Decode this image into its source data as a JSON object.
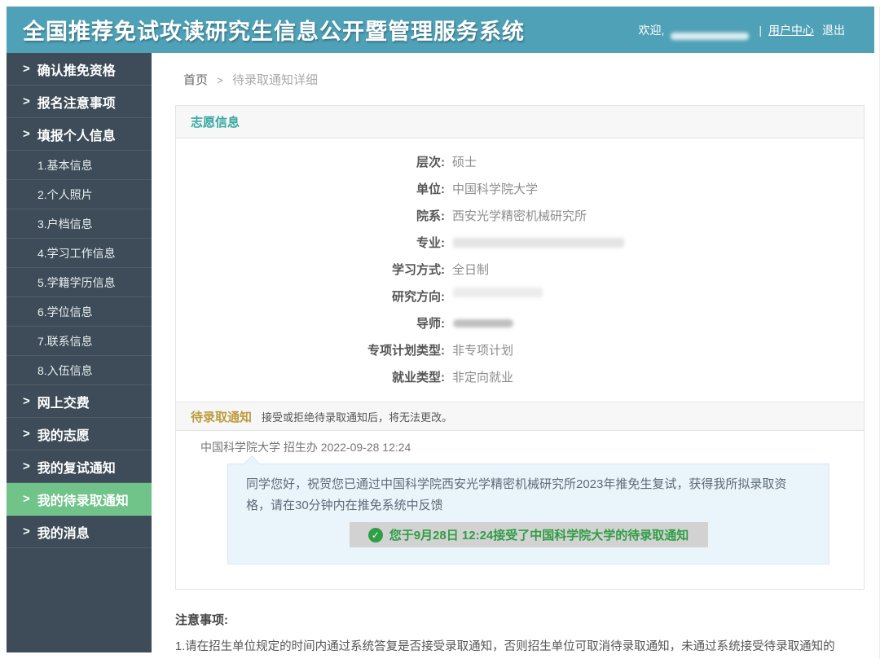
{
  "header": {
    "title": "全国推荐免试攻读研究生信息公开暨管理服务系统",
    "welcome": "欢迎,",
    "divider": "|",
    "user_center": "用户中心",
    "logout": "退出"
  },
  "sidebar": {
    "items": [
      {
        "id": "confirm-eligibility",
        "prefix": ">",
        "label": "确认推免资格",
        "level": 1,
        "active": false
      },
      {
        "id": "application-notes",
        "prefix": ">",
        "label": "报名注意事项",
        "level": 1,
        "active": false
      },
      {
        "id": "fill-personal-info",
        "prefix": ">",
        "label": "填报个人信息",
        "level": 1,
        "active": false
      },
      {
        "id": "basic-info",
        "prefix": "",
        "label": "1.基本信息",
        "level": 2,
        "active": false
      },
      {
        "id": "personal-photo",
        "prefix": "",
        "label": "2.个人照片",
        "level": 2,
        "active": false
      },
      {
        "id": "hukou-file-info",
        "prefix": "",
        "label": "3.户档信息",
        "level": 2,
        "active": false
      },
      {
        "id": "study-work-info",
        "prefix": "",
        "label": "4.学习工作信息",
        "level": 2,
        "active": false
      },
      {
        "id": "student-status-info",
        "prefix": "",
        "label": "5.学籍学历信息",
        "level": 2,
        "active": false
      },
      {
        "id": "degree-info",
        "prefix": "",
        "label": "6.学位信息",
        "level": 2,
        "active": false
      },
      {
        "id": "contact-info",
        "prefix": "",
        "label": "7.联系信息",
        "level": 2,
        "active": false
      },
      {
        "id": "enlistment-info",
        "prefix": "",
        "label": "8.入伍信息",
        "level": 2,
        "active": false
      },
      {
        "id": "online-payment",
        "prefix": ">",
        "label": "网上交费",
        "level": 1,
        "active": false
      },
      {
        "id": "my-volunteer",
        "prefix": ">",
        "label": "我的志愿",
        "level": 1,
        "active": false
      },
      {
        "id": "my-retest-notice",
        "prefix": ">",
        "label": "我的复试通知",
        "level": 1,
        "active": false
      },
      {
        "id": "my-pending-admission-notice",
        "prefix": ">",
        "label": "我的待录取通知",
        "level": 1,
        "active": true
      },
      {
        "id": "my-messages",
        "prefix": ">",
        "label": "我的消息",
        "level": 1,
        "active": false
      }
    ]
  },
  "breadcrumb": {
    "home": "首页",
    "sep": ">",
    "current": "待录取通知详细"
  },
  "panel": {
    "volunteer_header": "志愿信息",
    "fields": [
      {
        "id": "level",
        "label": "层次:",
        "value": "硕士",
        "redacted": false
      },
      {
        "id": "unit",
        "label": "单位:",
        "value": "中国科学院大学",
        "redacted": false
      },
      {
        "id": "department",
        "label": "院系:",
        "value": "西安光学精密机械研究所",
        "redacted": false
      },
      {
        "id": "major",
        "label": "专业:",
        "value": "",
        "redacted": true
      },
      {
        "id": "study-mode",
        "label": "学习方式:",
        "value": "全日制",
        "redacted": false
      },
      {
        "id": "research-direction",
        "label": "研究方向:",
        "value": "",
        "redacted": true
      },
      {
        "id": "supervisor",
        "label": "导师:",
        "value": "",
        "redacted": true
      },
      {
        "id": "special-plan-type",
        "label": "专项计划类型:",
        "value": "非专项计划",
        "redacted": false
      },
      {
        "id": "employment-type",
        "label": "就业类型:",
        "value": "非定向就业",
        "redacted": false
      }
    ],
    "notice_header": {
      "title": "待录取通知",
      "note": "接受或拒绝待录取通知后，将无法更改。"
    },
    "message": {
      "sender": "中国科学院大学 招生办 2022-09-28 12:24",
      "body": "同学您好，祝贺您已通过中国科学院西安光学精密机械研究所2023年推免生复试，获得我所拟录取资格，请在30分钟内在推免系统中反馈",
      "accept_status": "您于9月28日 12:24接受了中国科学院大学的待录取通知"
    }
  },
  "footer_notice": {
    "title": "注意事项:",
    "line1": "1.请在招生单位规定的时间内通过系统答复是否接受录取通知，否则招生单位可取消待录取通知，未通过系统接受待录取通知的"
  },
  "colors": {
    "header_teal": "#4fa1b7",
    "sidebar_dark": "#3d4c58",
    "active_green": "#70c389",
    "section_title_teal": "#3aa7a3",
    "pending_gold": "#bd9b3d",
    "success_green": "#2f9e44",
    "bubble_blue": "#eaf4fb"
  }
}
